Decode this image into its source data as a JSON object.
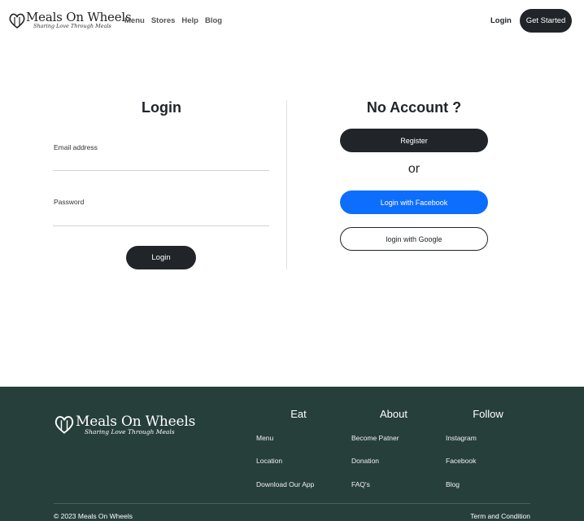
{
  "header": {
    "logo_title": "Meals On Wheels",
    "logo_tagline": "Sharing Love Through Meals",
    "nav": [
      "Menu",
      "Stores",
      "Help",
      "Blog"
    ],
    "login_label": "Login",
    "get_started_label": "Get Started"
  },
  "login": {
    "title": "Login",
    "email_label": "Email address",
    "password_label": "Password",
    "submit_label": "Login"
  },
  "signup": {
    "title": "No Account ?",
    "register_label": "Register",
    "or_label": "or",
    "facebook_label": "Login with Facebook",
    "google_label": "login with Google"
  },
  "footer": {
    "logo_title": "Meals On Wheels",
    "logo_tagline": "Sharing Love Through Meals",
    "columns": [
      {
        "heading": "Eat",
        "items": [
          "Menu",
          "Location",
          "Download Our App"
        ]
      },
      {
        "heading": "About",
        "items": [
          "Become Patner",
          "Donation",
          "FAQ's"
        ]
      },
      {
        "heading": "Follow",
        "items": [
          "Instagram",
          "Facebook",
          "Blog"
        ]
      }
    ],
    "copyright": "© 2023 Meals On Wheels",
    "terms": "Term and Condition"
  },
  "colors": {
    "primary_dark": "#212529",
    "facebook_blue": "#0d6efd",
    "footer_bg": "#263f3b"
  }
}
